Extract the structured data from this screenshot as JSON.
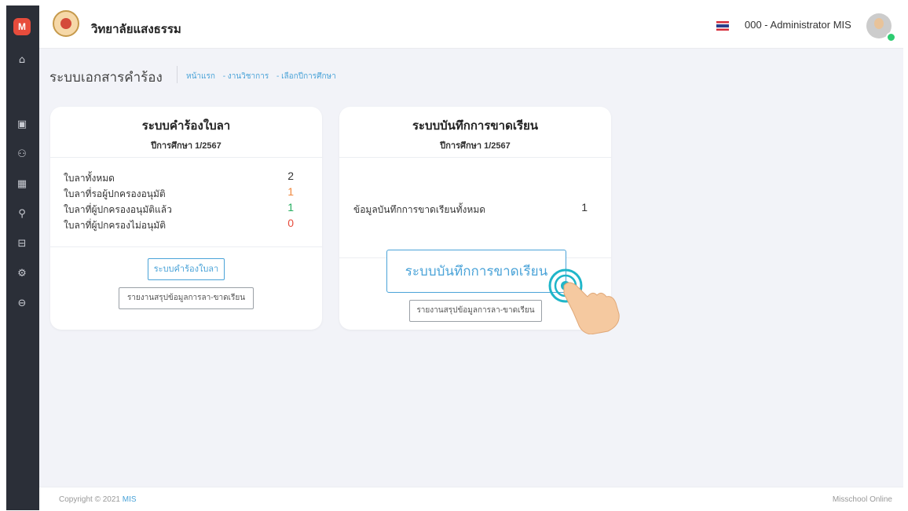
{
  "header": {
    "school_name": "วิทยาลัยแสงธรรม",
    "user_name": "000 - Administrator MIS",
    "logo_letter": "M"
  },
  "sidebar": {
    "icons": [
      "home-icon",
      "report-icon",
      "users-icon",
      "table-icon",
      "user-edit-icon",
      "document-icon",
      "user-settings-icon",
      "logout-icon"
    ],
    "glyphs": [
      "⌂",
      "▣",
      "⚇",
      "▦",
      "⚲",
      "⊟",
      "⚙",
      "⊖"
    ]
  },
  "page": {
    "title": "ระบบเอกสารคำร้อง",
    "breadcrumbs": [
      "หน้าแรก",
      "- งานวิชาการ",
      "- เลือกปีการศึกษา"
    ]
  },
  "leave_card": {
    "title": "ระบบคำร้องใบลา",
    "subtitle": "ปีการศึกษา 1/2567",
    "stats": [
      {
        "label": "ใบลาทั้งหมด",
        "value": "2",
        "color": "#333333"
      },
      {
        "label": "ใบลาที่รอผู้ปกครองอนุมัติ",
        "value": "1",
        "color": "#f0883e"
      },
      {
        "label": "ใบลาที่ผู้ปกครองอนุมัติแล้ว",
        "value": "1",
        "color": "#27ae60"
      },
      {
        "label": "ใบลาที่ผู้ปกครองไม่อนุมัติ",
        "value": "0",
        "color": "#e74c3c"
      }
    ],
    "button_primary": "ระบบคำร้องใบลา",
    "button_report": "รายงานสรุปข้อมูลการลา-ขาดเรียน"
  },
  "absence_card": {
    "title": "ระบบบันทึกการขาดเรียน",
    "subtitle": "ปีการศึกษา 1/2567",
    "stats": [
      {
        "label": "ข้อมูลบันทึกการขาดเรียนทั้งหมด",
        "value": "1"
      }
    ],
    "button_primary": "ระบบบันทึกการขาดเรียน",
    "button_report": "รายงานสรุปข้อมูลการลา-ขาดเรียน"
  },
  "footer": {
    "copyright_prefix": "Copyright © 2021 ",
    "copyright_brand": "MIS",
    "right_text": "Misschool Online"
  },
  "colors": {
    "accent": "#4aa3d8",
    "sidebar": "#2b2f38",
    "background": "#f2f3f8"
  }
}
